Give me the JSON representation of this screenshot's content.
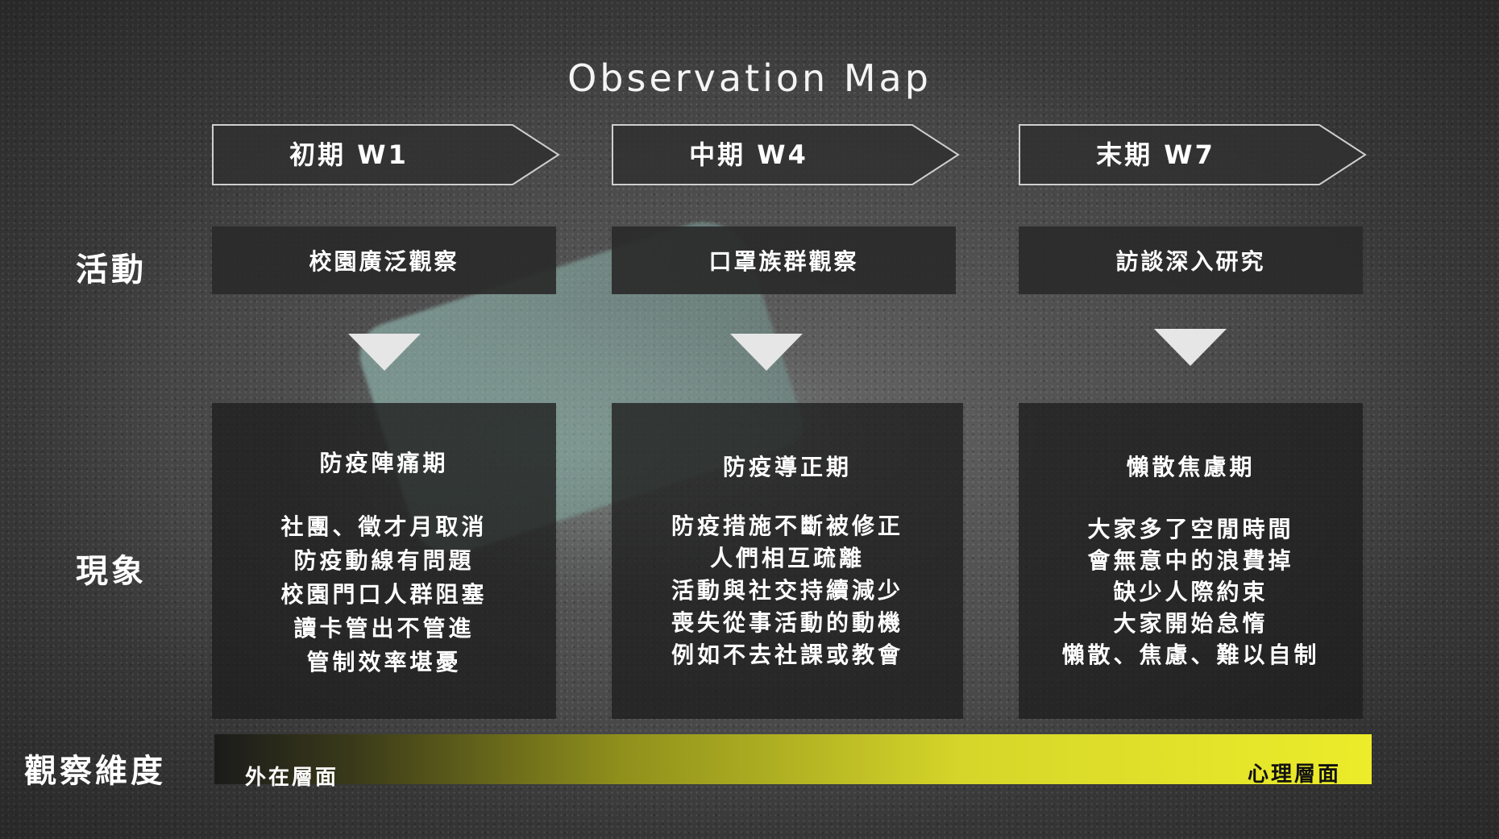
{
  "title": "Observation Map",
  "row_labels": {
    "activity": "活動",
    "phenomenon": "現象",
    "dimension": "觀察維度"
  },
  "phases": [
    {
      "period": "初期 W1",
      "activity": "校園廣泛觀察",
      "phase_title": "防疫陣痛期",
      "phenomena": [
        "社團、徵才月取消",
        "防疫動線有問題",
        "校園門口人群阻塞",
        "讀卡管出不管進",
        "管制效率堪憂"
      ]
    },
    {
      "period": "中期 W4",
      "activity": "口罩族群觀察",
      "phase_title": "防疫導正期",
      "phenomena": [
        "防疫措施不斷被修正",
        "人們相互疏離",
        "活動與社交持續減少",
        "喪失從事活動的動機",
        "例如不去社課或教會"
      ]
    },
    {
      "period": "末期 W7",
      "activity": "訪談深入研究",
      "phase_title": "懶散焦慮期",
      "phenomena": [
        "大家多了空閒時間",
        "會無意中的浪費掉",
        "缺少人際約束",
        "大家開始怠惰",
        "懶散、焦慮、難以自制"
      ]
    }
  ],
  "dimension": {
    "left_label": "外在層面",
    "right_label": "心理層面"
  },
  "colors": {
    "box_dark": "#2a2a2a",
    "gradient_end": "#ecec2a"
  }
}
